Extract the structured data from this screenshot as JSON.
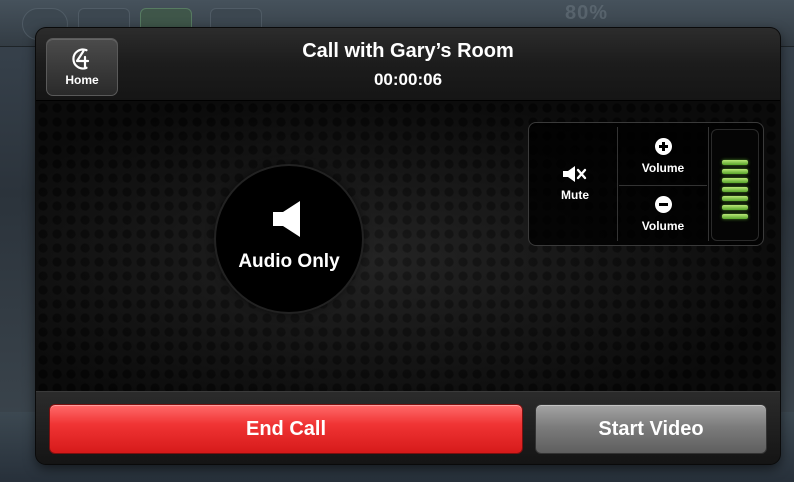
{
  "background": {
    "status_percent": "80%"
  },
  "call": {
    "title": "Call with Gary’s Room",
    "timer": "00:00:06",
    "mode_label": "Audio Only"
  },
  "header": {
    "home_label": "Home",
    "home_icon": "home-icon"
  },
  "audio_controls": {
    "mute_label": "Mute",
    "volume_up_label": "Volume",
    "volume_down_label": "Volume",
    "volume_level_segments_lit": 7,
    "volume_level_segments_total": 7
  },
  "actions": {
    "end_call_label": "End Call",
    "start_video_label": "Start Video"
  },
  "colors": {
    "end_call": "#f03434",
    "start_video": "#7c7c7c",
    "meter_green": "#8fd24f"
  }
}
